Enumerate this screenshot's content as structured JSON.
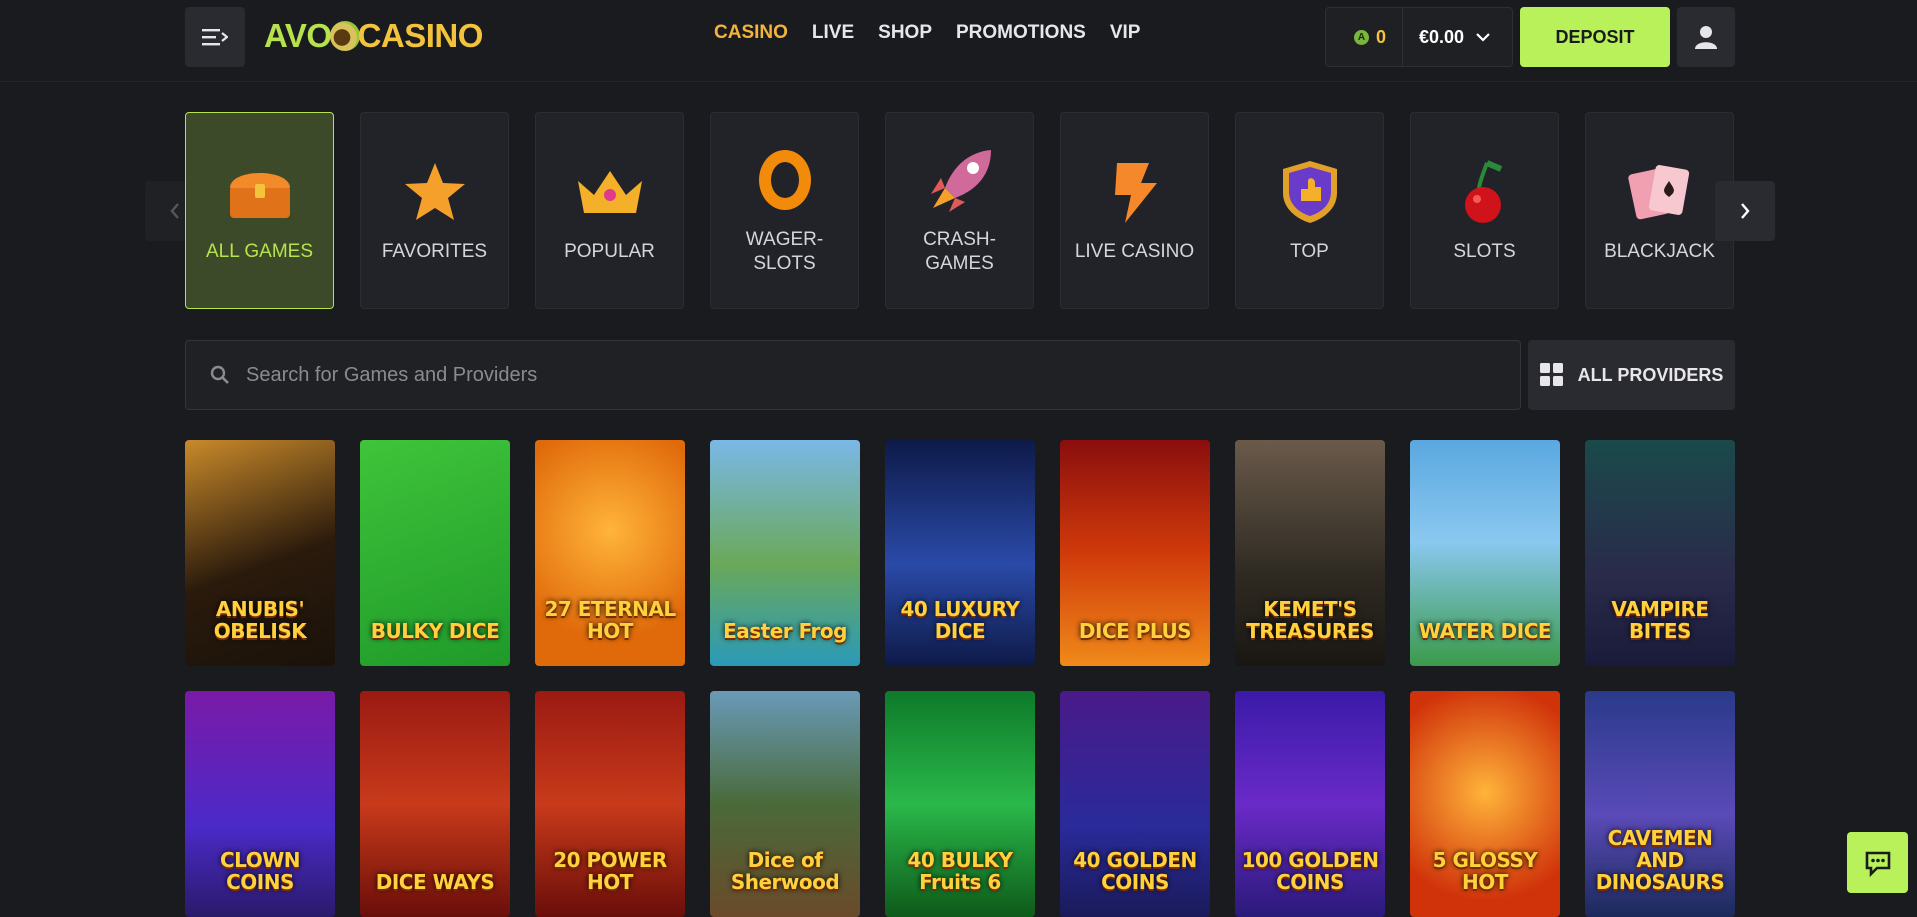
{
  "header": {
    "logo_left": "AVO",
    "logo_right": "CASINO",
    "nav": [
      {
        "label": "CASINO",
        "active": true
      },
      {
        "label": "LIVE",
        "active": false
      },
      {
        "label": "SHOP",
        "active": false
      },
      {
        "label": "PROMOTIONS",
        "active": false
      },
      {
        "label": "VIP",
        "active": false
      }
    ],
    "coins": "0",
    "coin_symbol": "A",
    "balance": "€0.00",
    "deposit_label": "DEPOSIT"
  },
  "categories": [
    {
      "label": "ALL GAMES",
      "icon": "chest-icon",
      "active": true
    },
    {
      "label": "FAVORITES",
      "icon": "star-icon",
      "active": false
    },
    {
      "label": "POPULAR",
      "icon": "crown-icon",
      "active": false
    },
    {
      "label": "WAGER-\nSLOTS",
      "icon": "ring-icon",
      "active": false
    },
    {
      "label": "CRASH-\nGAMES",
      "icon": "rocket-icon",
      "active": false
    },
    {
      "label": "LIVE CASINO",
      "icon": "lightning-icon",
      "active": false
    },
    {
      "label": "TOP",
      "icon": "shield-thumb-icon",
      "active": false
    },
    {
      "label": "SLOTS",
      "icon": "cherry-icon",
      "active": false
    },
    {
      "label": "BLACKJACK",
      "icon": "cards-icon",
      "active": false
    }
  ],
  "search": {
    "placeholder": "Search for Games and Providers"
  },
  "providers_label": "ALL PROVIDERS",
  "games": [
    {
      "title": "ANUBIS' OBELISK",
      "bg": "linear-gradient(160deg,#c98a2a,#2a1a0c 55%,#1a120a)"
    },
    {
      "title": "BULKY DICE",
      "bg": "linear-gradient(160deg,#3fc43a,#1f9a2a)"
    },
    {
      "title": "27 ETERNAL HOT",
      "bg": "radial-gradient(circle at 50% 40%,#ffb43a,#e06a0a 70%)"
    },
    {
      "title": "Easter Frog",
      "bg": "linear-gradient(180deg,#7ab8e6,#6aa85a 55%,#2a9ab8)"
    },
    {
      "title": "40 LUXURY DICE",
      "bg": "linear-gradient(180deg,#0e1a48,#2a4aa8 55%,#0e1a48)"
    },
    {
      "title": "DICE PLUS",
      "bg": "linear-gradient(180deg,#8a0e0e,#d03a0a 50%,#f08a1a)"
    },
    {
      "title": "KEMET'S TREASURES",
      "bg": "linear-gradient(180deg,#6a5a4a,#2e2a22 60%,#1a1612)"
    },
    {
      "title": "WATER DICE",
      "bg": "linear-gradient(180deg,#5aa8e0,#8ac8f0 45%,#3a9a4a)"
    },
    {
      "title": "VAMPIRE BITES",
      "bg": "linear-gradient(180deg,#1a4a4a,#2a2a4a 60%,#1a1a3a)"
    },
    {
      "title": "CLOWN COINS",
      "bg": "linear-gradient(180deg,#7a1aa8,#4a2ac8 60%,#2a1a6a)"
    },
    {
      "title": "DICE WAYS",
      "bg": "linear-gradient(180deg,#9a1a12,#c83a1a 50%,#6a0e0a)"
    },
    {
      "title": "20 POWER HOT",
      "bg": "linear-gradient(180deg,#9a1a12,#c83a1a 50%,#6a0e0a)"
    },
    {
      "title": "Dice of Sherwood",
      "bg": "linear-gradient(180deg,#6a9ab8,#4a6a3a 50%,#6a4a2a)"
    },
    {
      "title": "40 BULKY Fruits 6",
      "bg": "linear-gradient(180deg,#0e7a2a,#2ab84a 50%,#0e5a1a)"
    },
    {
      "title": "40 GOLDEN COINS",
      "bg": "linear-gradient(180deg,#4a1a8a,#2a2a9a 60%,#1a1a5a)"
    },
    {
      "title": "100 GOLDEN COINS",
      "bg": "linear-gradient(180deg,#3a1aa8,#6a2ac8 50%,#2a1a7a)"
    },
    {
      "title": "5 GLOSSY HOT",
      "bg": "radial-gradient(circle at 50% 45%,#ffb43a,#d0320a 75%)"
    },
    {
      "title": "CAVEMEN AND DINOSAURS",
      "bg": "linear-gradient(180deg,#2a3a8a,#5a4ab8 55%,#1a2a5a)"
    }
  ]
}
